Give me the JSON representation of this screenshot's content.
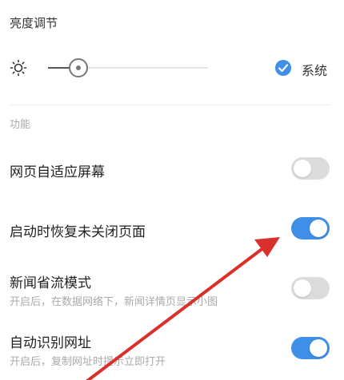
{
  "brightness": {
    "section_title": "亮度调节",
    "icon": "sun-icon",
    "level": 0.19,
    "system_checked": true,
    "system_label": "系统"
  },
  "function_group": {
    "label": "功能"
  },
  "settings": [
    {
      "title": "网页自适应屏幕",
      "desc": "",
      "enabled": false
    },
    {
      "title": "启动时恢复未关闭页面",
      "desc": "",
      "enabled": true
    },
    {
      "title": "新闻省流模式",
      "desc": "开启后，在数据网络下，新闻详情页显示小图",
      "enabled": false
    },
    {
      "title": "自动识别网址",
      "desc": "开启后，复制网址时提示立即打开",
      "enabled": true
    }
  ],
  "colors": {
    "accent": "#3f8ee8",
    "annotation_arrow": "#d9302c"
  }
}
